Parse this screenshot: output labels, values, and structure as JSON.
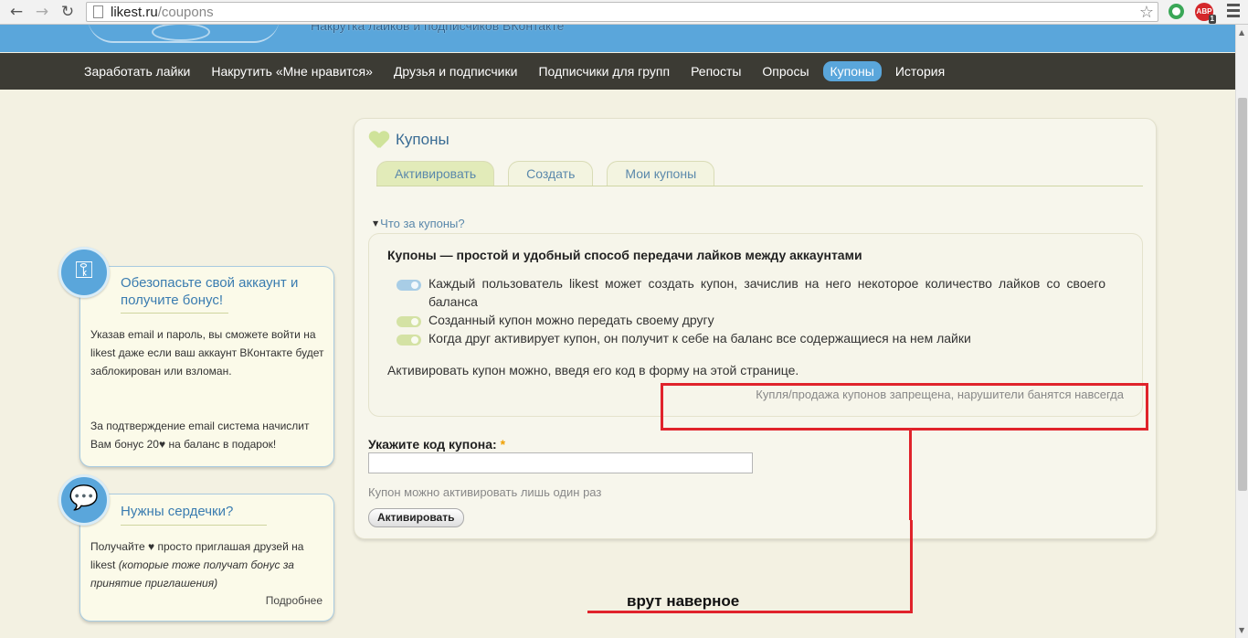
{
  "browser": {
    "url_domain": "likest.ru",
    "url_path": "/coupons",
    "back_glyph": "←",
    "forward_glyph": "→",
    "reload_glyph": "↻",
    "star_glyph": "☆",
    "adblock_label": "ABP",
    "adblock_count": "1"
  },
  "site": {
    "tagline": "Накрутка лайков и подписчиков ВКонтакте"
  },
  "nav": {
    "items": [
      {
        "label": "Заработать лайки",
        "active": false
      },
      {
        "label": "Накрутить «Мне нравится»",
        "active": false
      },
      {
        "label": "Друзья и подписчики",
        "active": false
      },
      {
        "label": "Подписчики для групп",
        "active": false
      },
      {
        "label": "Репосты",
        "active": false
      },
      {
        "label": "Опросы",
        "active": false
      },
      {
        "label": "Купоны",
        "active": true
      },
      {
        "label": "История",
        "active": false
      }
    ]
  },
  "panel": {
    "title": "Купоны",
    "tabs": [
      {
        "label": "Активировать",
        "active": true
      },
      {
        "label": "Создать",
        "active": false
      },
      {
        "label": "Мои купоны",
        "active": false
      }
    ],
    "faq_toggle": "Что за купоны?",
    "info": {
      "title": "Купоны — простой и удобный способ передачи лайков между аккаунтами",
      "items": [
        "Каждый пользователь likest может создать купон, зачислив на него некоторое количество лайков со своего баланса",
        "Созданный купон можно передать своему другу",
        "Когда друг активирует купон, он получит к себе на баланс все содержащиеся на нем лайки"
      ],
      "note": "Активировать купон можно, введя его код в форму на этой странице.",
      "warning": "Купля/продажа купонов запрещена, нарушители банятся навсегда"
    },
    "form": {
      "label": "Укажите код купона:",
      "required_mark": "*",
      "value": "",
      "hint": "Купон можно активировать лишь один раз",
      "button": "Активировать"
    }
  },
  "widgets": {
    "secure": {
      "icon": "key-heart-icon",
      "title": "Обезопасьте свой аккаунт и получите бонус!",
      "body_1": "Указав email и пароль, вы сможете войти на likest даже если ваш аккаунт ВКонтакте будет заблокирован или взломан.",
      "body_2": "За подтверждение email система начислит Вам бонус 20♥ на баланс в подарок!"
    },
    "hearts": {
      "icon": "speech-bubble-icon",
      "title": "Нужны сердечки?",
      "body_plain": "Получайте ♥ просто приглашая друзей на likest",
      "body_italic": "(которые тоже получат бонус за принятие приглашения)",
      "more": "Подробнее"
    }
  },
  "annotation": {
    "text": "врут наверное",
    "color": "#e0232b"
  }
}
